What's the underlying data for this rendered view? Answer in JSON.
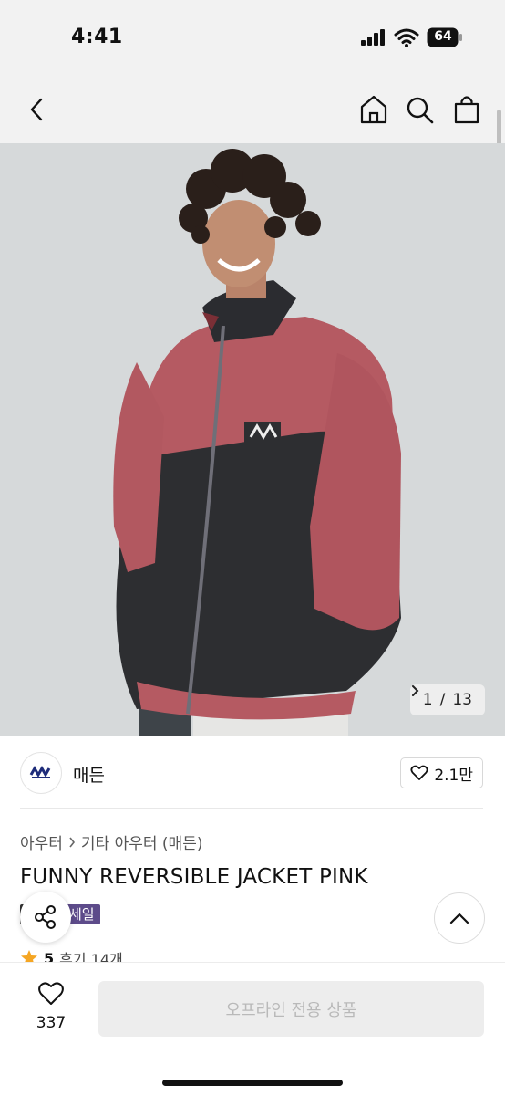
{
  "status_bar": {
    "time": "4:41",
    "battery": "64"
  },
  "header": {
    "back": "back",
    "icons": [
      "home-icon",
      "search-icon",
      "shopping-bag-icon"
    ]
  },
  "gallery": {
    "current": "1",
    "total": "13",
    "separator": "/"
  },
  "brand": {
    "name": "매든",
    "likes": "2.1만"
  },
  "breadcrumb": {
    "level1": "아우터",
    "level2": "기타 아우터 (매든)"
  },
  "product": {
    "title": "FUNNY REVERSIBLE JACKET PINK",
    "badge": "세일"
  },
  "rating": {
    "score": "5",
    "reviews": "후기 14개"
  },
  "bottom": {
    "wish_count": "337",
    "purchase_label": "오프라인 전용 상품"
  },
  "colors": {
    "accent": "#5d4b8a",
    "star": "#f5a623",
    "disabled": "#ededed"
  }
}
